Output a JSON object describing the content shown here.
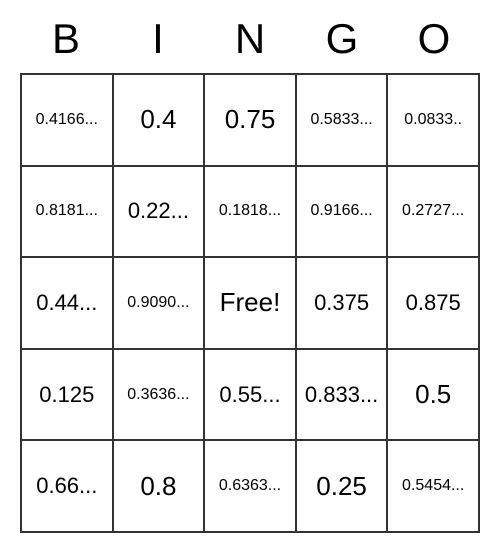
{
  "header": [
    "B",
    "I",
    "N",
    "G",
    "O"
  ],
  "grid": [
    [
      {
        "value": "0.4166...",
        "size": "small"
      },
      {
        "value": "0.4",
        "size": "large"
      },
      {
        "value": "0.75",
        "size": "large"
      },
      {
        "value": "0.5833...",
        "size": "small"
      },
      {
        "value": "0.0833..",
        "size": "small"
      }
    ],
    [
      {
        "value": "0.8181...",
        "size": "small"
      },
      {
        "value": "0.22...",
        "size": "medium"
      },
      {
        "value": "0.1818...",
        "size": "small"
      },
      {
        "value": "0.9166...",
        "size": "small"
      },
      {
        "value": "0.2727...",
        "size": "small"
      }
    ],
    [
      {
        "value": "0.44...",
        "size": "medium"
      },
      {
        "value": "0.9090...",
        "size": "small"
      },
      {
        "value": "Free!",
        "size": "free"
      },
      {
        "value": "0.375",
        "size": "medium"
      },
      {
        "value": "0.875",
        "size": "medium"
      }
    ],
    [
      {
        "value": "0.125",
        "size": "medium"
      },
      {
        "value": "0.3636...",
        "size": "small"
      },
      {
        "value": "0.55...",
        "size": "medium"
      },
      {
        "value": "0.833...",
        "size": "medium"
      },
      {
        "value": "0.5",
        "size": "large"
      }
    ],
    [
      {
        "value": "0.66...",
        "size": "medium"
      },
      {
        "value": "0.8",
        "size": "large"
      },
      {
        "value": "0.6363...",
        "size": "small"
      },
      {
        "value": "0.25",
        "size": "large"
      },
      {
        "value": "0.5454...",
        "size": "small"
      }
    ]
  ]
}
